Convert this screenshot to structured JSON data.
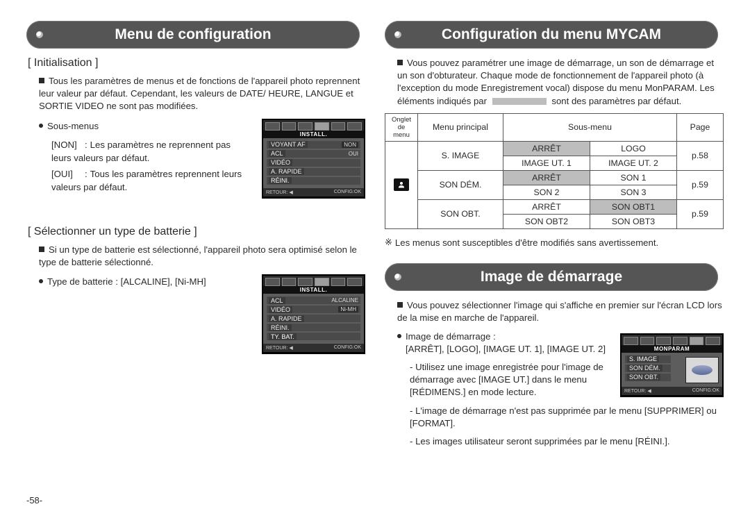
{
  "page_number": "-58-",
  "left": {
    "title": "Menu de configuration",
    "init": {
      "heading": "[ Initialisation ]",
      "p1": "Tous les paramètres de menus et de fonctions de l'appareil photo reprennent leur valeur par défaut. Cependant, les valeurs de DATE/ HEURE, LANGUE et SORTIE VIDEO ne sont pas modifiées.",
      "subs_label": "Sous-menus",
      "non_term": "[NON]",
      "non_def": "Les paramètres ne reprennent pas leurs valeurs par défaut.",
      "oui_term": "[OUI]",
      "oui_def": "Tous les paramètres reprennent leurs valeurs par défaut."
    },
    "batt": {
      "heading": "[ Sélectionner un type de batterie ]",
      "p1": "Si un type de batterie est sélectionné, l'appareil photo sera optimisé selon le type de batterie sélectionné.",
      "types_label": "Type de batterie : [ALCALINE], [Ni-MH]"
    }
  },
  "right": {
    "title1": "Configuration du menu MYCAM",
    "intro": "Vous pouvez paramétrer une image de démarrage, un son de démarrage et un son d'obturateur. Chaque mode de fonctionnement de l'appareil photo (à l'exception du mode Enregistrement vocal) dispose du menu MonPARAM. Les éléments indiqués par",
    "intro_tail": "sont des paramètres par défaut.",
    "table": {
      "h_tab": "Onglet de menu",
      "h_main": "Menu principal",
      "h_sub": "Sous-menu",
      "h_page": "Page",
      "r1": {
        "main": "S. IMAGE",
        "a": "ARRÊT",
        "b": "LOGO",
        "c": "IMAGE UT. 1",
        "d": "IMAGE UT. 2",
        "page": "p.58"
      },
      "r2": {
        "main": "SON DÉM.",
        "a": "ARRÊT",
        "b": "SON 1",
        "c": "SON 2",
        "d": "SON 3",
        "page": "p.59"
      },
      "r3": {
        "main": "SON OBT.",
        "a": "ARRÊT",
        "b": "SON OBT1",
        "c": "SON OBT2",
        "d": "SON OBT3",
        "page": "p.59"
      }
    },
    "note": "Les menus sont susceptibles d'être modifiés sans avertissement.",
    "title2": "Image de démarrage",
    "start": {
      "p1": "Vous pouvez sélectionner l'image qui s'affiche en premier sur l'écran LCD lors de la mise en marche de l'appareil.",
      "label": "Image de démarrage :",
      "options": "[ARRÊT], [LOGO], [IMAGE UT. 1], [IMAGE UT. 2]",
      "b1": "Utilisez une image enregistrée pour l'image de démarrage avec [IMAGE UT.] dans le menu [RÉDIMENS.] en mode lecture.",
      "b2": "L'image de démarrage n'est pas supprimée par le menu [SUPPRIMER] ou [FORMAT].",
      "b3": "Les images utilisateur seront supprimées par le menu [RÉINI.]."
    }
  },
  "lcd": {
    "install_title": "INSTALL.",
    "monparam_title": "MONPARAM",
    "foot_l": "RETOUR: ◀",
    "foot_r": "CONFIG:OK",
    "init_rows": {
      "r1l": "VOYANT AF",
      "r1r": "NON",
      "r2l": "ACL",
      "r2r": "OUI",
      "r3l": "VIDÉO",
      "r4l": "A. RAPIDE",
      "r5l": "RÉINI."
    },
    "batt_rows": {
      "r1l": "ACL",
      "r1r": "ALCALINE",
      "r2l": "VIDÉO",
      "r2r": "Ni-MH",
      "r3l": "A. RAPIDE",
      "r4l": "RÉINI.",
      "r5l": "TY. BAT."
    },
    "start_rows": {
      "r1": "S. IMAGE",
      "r2": "SON DÉM.",
      "r3": "SON OBT."
    }
  }
}
